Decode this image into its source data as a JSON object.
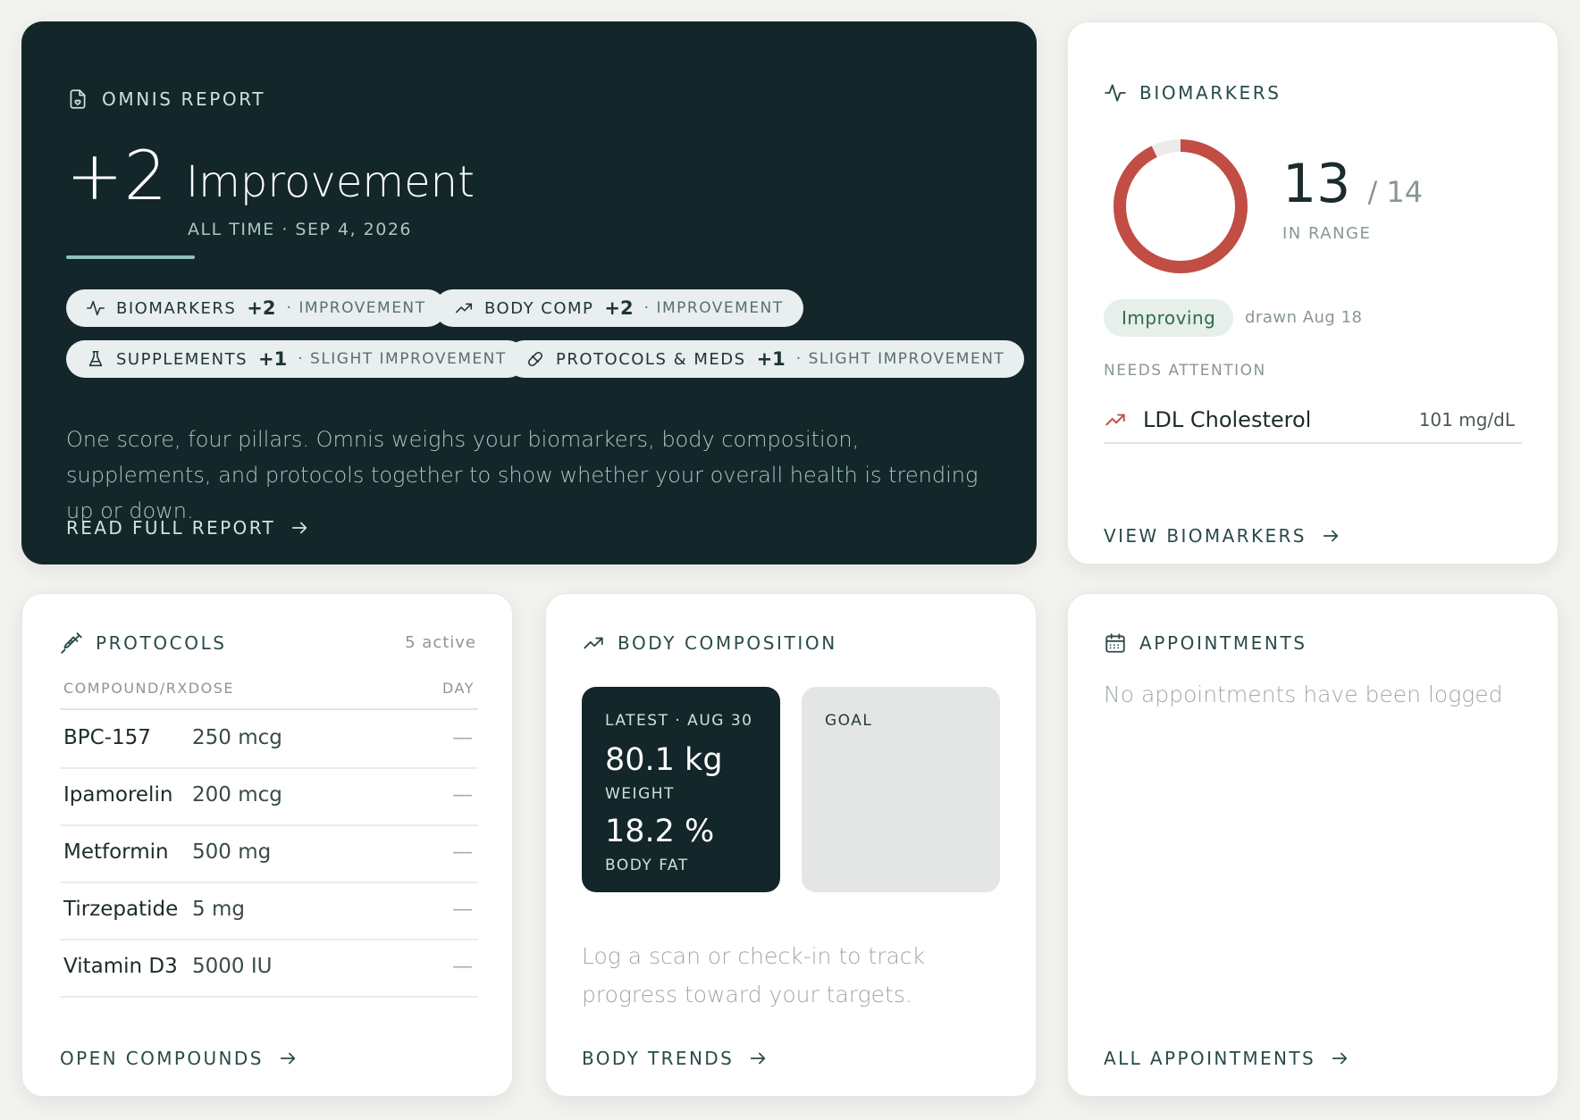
{
  "hero": {
    "header": "OMNIS REPORT",
    "score": "+2",
    "score_label": "Improvement",
    "period": "ALL TIME · SEP 4, 2026",
    "chips": [
      {
        "label": "BIOMARKERS",
        "points": "+2",
        "level": "· IMPROVEMENT",
        "icon": "pulse-icon"
      },
      {
        "label": "BODY COMP",
        "points": "+2",
        "level": "· IMPROVEMENT",
        "icon": "trend-up-icon"
      },
      {
        "label": "SUPPLEMENTS",
        "points": "+1",
        "level": "· SLIGHT IMPROVEMENT",
        "icon": "flask-icon"
      },
      {
        "label": "PROTOCOLS & MEDS",
        "points": "+1",
        "level": "· SLIGHT IMPROVEMENT",
        "icon": "pill-icon"
      }
    ],
    "description": "One score, four pillars. Omnis weighs your biomarkers, body composition, supplements, and protocols together to show whether your overall health is trending up or down.",
    "link": "READ FULL REPORT"
  },
  "biomarkers": {
    "header": "BIOMARKERS",
    "in_range": "13",
    "total": "/ 14",
    "in_range_fraction": 0.9286,
    "in_range_label": "IN RANGE",
    "status": "Improving",
    "drawn": "drawn Aug 18",
    "needs_attention_label": "NEEDS ATTENTION",
    "attention": {
      "name": "LDL Cholesterol",
      "value": "101 mg/dL"
    },
    "link": "VIEW BIOMARKERS",
    "ring_color": "#c14d44"
  },
  "protocols": {
    "header": "PROTOCOLS",
    "active": "5 active",
    "columns": {
      "compound": "COMPOUND/RXDOSE",
      "day": "DAY"
    },
    "rows": [
      {
        "name": "BPC-157",
        "dose": "250 mcg",
        "day": "—"
      },
      {
        "name": "Ipamorelin",
        "dose": "200 mcg",
        "day": "—"
      },
      {
        "name": "Metformin",
        "dose": "500 mg",
        "day": "—"
      },
      {
        "name": "Tirzepatide",
        "dose": "5 mg",
        "day": "—"
      },
      {
        "name": "Vitamin D3",
        "dose": "5000 IU",
        "day": "—"
      }
    ],
    "link": "OPEN COMPOUNDS"
  },
  "body_composition": {
    "header": "BODY COMPOSITION",
    "latest_label": "LATEST · AUG 30",
    "weight": "80.1 kg",
    "weight_label": "WEIGHT",
    "body_fat": "18.2 %",
    "body_fat_label": "BODY FAT",
    "goal_label": "GOAL",
    "note": "Log a scan or check-in to track progress toward your targets.",
    "link": "BODY TRENDS"
  },
  "appointments": {
    "header": "APPOINTMENTS",
    "empty": "No appointments have been logged",
    "link": "ALL APPOINTMENTS"
  }
}
